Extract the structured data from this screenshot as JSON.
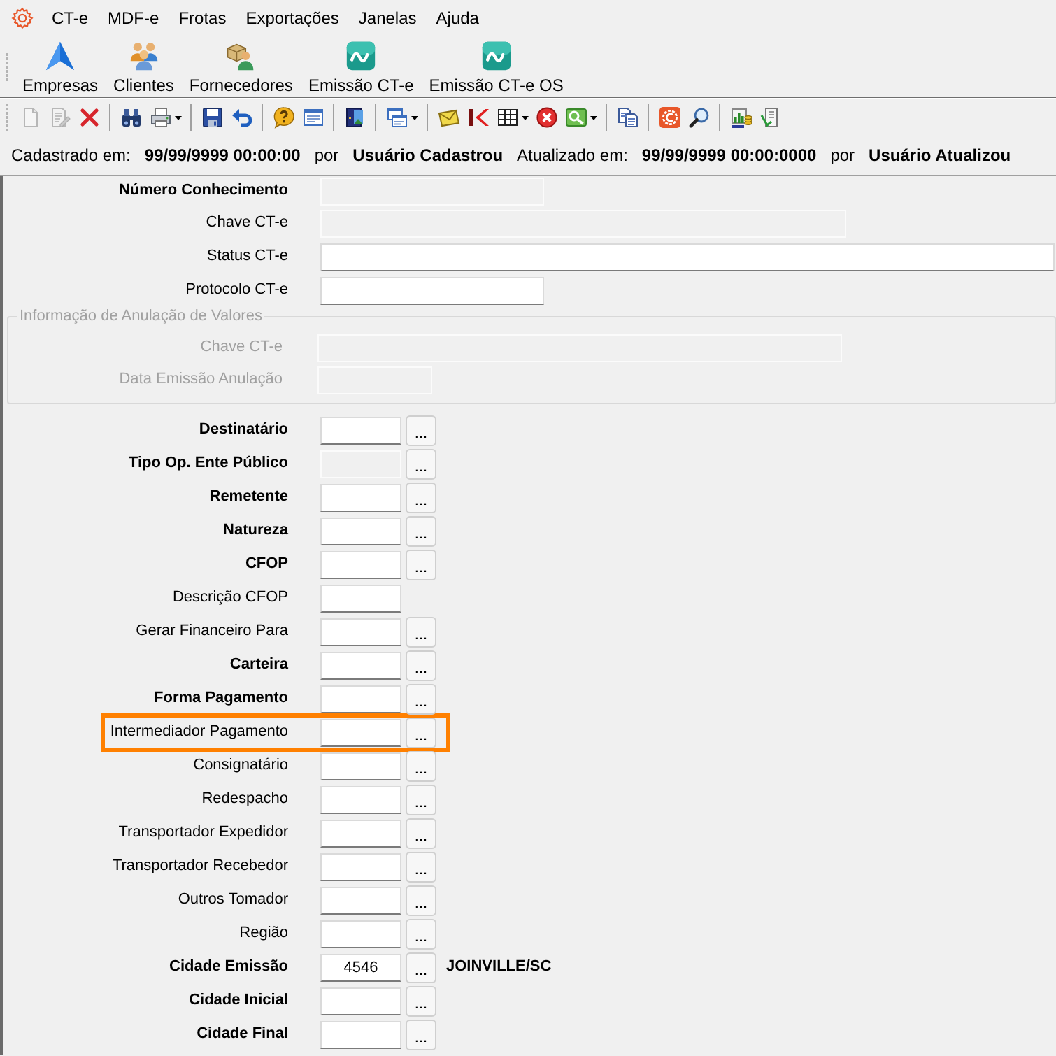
{
  "menu": {
    "items": [
      "CT-e",
      "MDF-e",
      "Frotas",
      "Exportações",
      "Janelas",
      "Ajuda"
    ]
  },
  "launcher": [
    {
      "label": "Empresas"
    },
    {
      "label": "Clientes"
    },
    {
      "label": "Fornecedores"
    },
    {
      "label": "Emissão CT-e"
    },
    {
      "label": "Emissão CT-e OS"
    }
  ],
  "toolbar": [
    [
      {
        "disabled": true,
        "dropdown": false
      },
      {
        "disabled": true,
        "dropdown": false
      },
      {
        "disabled": false,
        "dropdown": false
      }
    ],
    [
      {
        "disabled": false,
        "dropdown": false
      },
      {
        "disabled": false,
        "dropdown": true
      }
    ],
    [
      {
        "disabled": false,
        "dropdown": false
      },
      {
        "disabled": false,
        "dropdown": false
      }
    ],
    [
      {
        "disabled": false,
        "dropdown": false
      },
      {
        "disabled": false,
        "dropdown": false
      }
    ],
    [
      {
        "disabled": false,
        "dropdown": false
      }
    ],
    [
      {
        "disabled": false,
        "dropdown": true
      }
    ],
    [
      {
        "disabled": false,
        "dropdown": false
      },
      {
        "disabled": false,
        "dropdown": false
      },
      {
        "disabled": false,
        "dropdown": true
      },
      {
        "disabled": false,
        "dropdown": false
      },
      {
        "disabled": false,
        "dropdown": true
      }
    ],
    [
      {
        "disabled": false,
        "dropdown": false
      }
    ],
    [
      {
        "disabled": false,
        "dropdown": false
      },
      {
        "disabled": false,
        "dropdown": false
      }
    ],
    [
      {
        "disabled": false,
        "dropdown": false
      },
      {
        "disabled": false,
        "dropdown": false
      }
    ]
  ],
  "audit": {
    "created_label": "Cadastrado em:",
    "created_at": "99/99/9999 00:00:00",
    "created_by_label": "por",
    "created_by": "Usuário Cadastrou",
    "updated_label": "Atualizado em:",
    "updated_at": "99/99/9999 00:00:0000",
    "updated_by_label": "por",
    "updated_by": "Usuário Atualizou"
  },
  "form": {
    "top_fields": [
      {
        "label": "Número Conhecimento",
        "kind": "number",
        "required": true,
        "disabled": true
      },
      {
        "label": "Chave CT-e",
        "kind": "key",
        "required": false,
        "disabled": true
      },
      {
        "label": "Status CT-e",
        "kind": "text",
        "required": false,
        "disabled": false
      },
      {
        "label": "Protocolo CT-e",
        "kind": "number",
        "required": false,
        "disabled": false
      }
    ],
    "cancellation": {
      "title": "Informação de Anulação de Valores",
      "disabled": true,
      "fields": [
        {
          "label": "Chave CT-e",
          "kind": "key",
          "disabled": true
        },
        {
          "label": "Data Emissão Anulação",
          "kind": "date",
          "disabled": true
        }
      ]
    },
    "fields": [
      {
        "label": "Destinatário",
        "required": true,
        "disabled": false,
        "highlighted": false,
        "button": "..."
      },
      {
        "label": "Tipo Op. Ente Público",
        "required": true,
        "disabled": true,
        "highlighted": false,
        "button": "..."
      },
      {
        "label": "Remetente",
        "required": true,
        "disabled": false,
        "highlighted": false,
        "button": "..."
      },
      {
        "label": "Natureza",
        "required": true,
        "disabled": false,
        "highlighted": false,
        "button": "..."
      },
      {
        "label": "CFOP",
        "required": true,
        "disabled": false,
        "highlighted": false,
        "button": "..."
      },
      {
        "label": "Descrição CFOP",
        "required": false,
        "disabled": false,
        "highlighted": false
      },
      {
        "label": "Gerar Financeiro Para",
        "required": false,
        "disabled": false,
        "highlighted": false,
        "button": "..."
      },
      {
        "label": "Carteira",
        "required": true,
        "disabled": false,
        "highlighted": false,
        "button": "..."
      },
      {
        "label": "Forma Pagamento",
        "required": true,
        "disabled": false,
        "highlighted": false,
        "button": "..."
      },
      {
        "label": "Intermediador Pagamento",
        "required": false,
        "disabled": false,
        "highlighted": true,
        "button": "..."
      },
      {
        "label": "Consignatário",
        "required": false,
        "disabled": false,
        "highlighted": false,
        "button": "..."
      },
      {
        "label": "Redespacho",
        "required": false,
        "disabled": false,
        "highlighted": false,
        "button": "..."
      },
      {
        "label": "Transportador Expedidor",
        "required": false,
        "disabled": false,
        "highlighted": false,
        "button": "..."
      },
      {
        "label": "Transportador Recebedor",
        "required": false,
        "disabled": false,
        "highlighted": false,
        "button": "..."
      },
      {
        "label": "Outros Tomador",
        "required": false,
        "disabled": false,
        "highlighted": false,
        "button": "..."
      },
      {
        "label": "Região",
        "required": false,
        "disabled": false,
        "highlighted": false,
        "button": "..."
      },
      {
        "label": "Cidade Emissão",
        "required": true,
        "disabled": false,
        "highlighted": false,
        "button": "...",
        "value": "4546",
        "description": "JOINVILLE/SC"
      },
      {
        "label": "Cidade Inicial",
        "required": true,
        "disabled": false,
        "highlighted": false,
        "button": "..."
      },
      {
        "label": "Cidade Final",
        "required": true,
        "disabled": false,
        "highlighted": false,
        "button": "..."
      }
    ]
  }
}
